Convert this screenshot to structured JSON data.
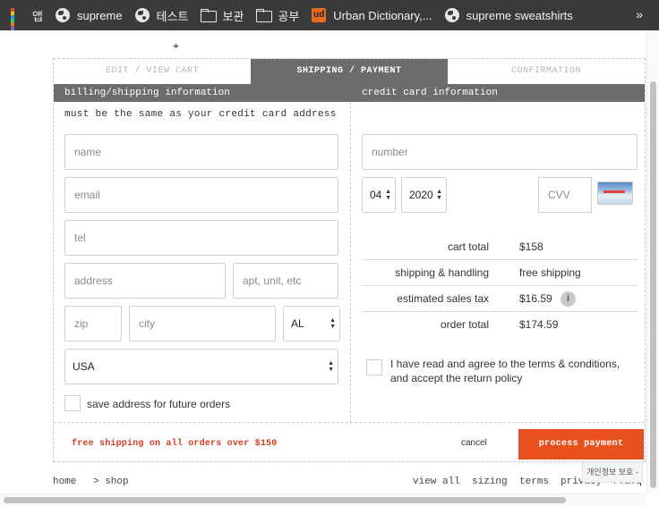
{
  "bookmarks": {
    "items": [
      {
        "label": "앱",
        "icon": "apps-icon"
      },
      {
        "label": "supreme",
        "icon": "globe-icon"
      },
      {
        "label": "테스트",
        "icon": "globe-icon"
      },
      {
        "label": "보관",
        "icon": "folder-icon"
      },
      {
        "label": "공부",
        "icon": "folder-icon"
      },
      {
        "label": "Urban Dictionary,...",
        "icon": "ud-icon"
      },
      {
        "label": "supreme sweatshirts",
        "icon": "globe-icon"
      }
    ],
    "overflow": "»"
  },
  "checkout": {
    "tabs": [
      "EDIT / VIEW CART",
      "SHIPPING / PAYMENT",
      "CONFIRMATION"
    ],
    "billing_header": "billing/shipping information",
    "card_header": "credit card information",
    "note": "must be the same as your credit card address",
    "fields": {
      "name": "name",
      "email": "email",
      "tel": "tel",
      "address": "address",
      "apt": "apt, unit, etc",
      "zip": "zip",
      "city": "city",
      "state": "AL",
      "country": "USA",
      "number": "number",
      "exp_month": "04",
      "exp_year": "2020",
      "cvv": "CVV"
    },
    "save_address": "save address for future orders",
    "totals": [
      {
        "label": "cart total",
        "value": "$158"
      },
      {
        "label": "shipping & handling",
        "value": "free shipping"
      },
      {
        "label": "estimated sales tax",
        "value": "$16.59"
      },
      {
        "label": "order total",
        "value": "$174.59"
      }
    ],
    "info_glyph": "i",
    "terms": "I have read and agree to the terms & conditions, and accept the return policy",
    "free_shipping": "free shipping on all orders over $150",
    "cancel": "cancel",
    "process": "process payment",
    "accent": "#e8501d"
  },
  "footer": {
    "home": "home",
    "shop": "> shop",
    "links": [
      "view all",
      "sizing",
      "terms",
      "privacy",
      "f.a.q"
    ],
    "privacy_badge": "개인정보 보호 -"
  }
}
